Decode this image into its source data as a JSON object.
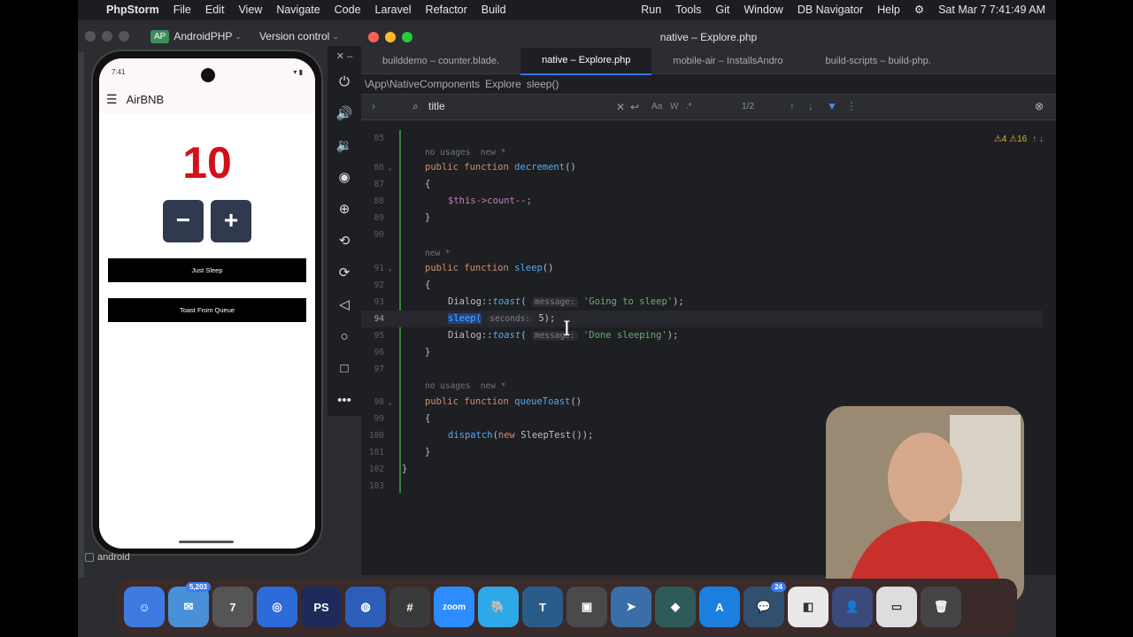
{
  "menubar": {
    "app": "PhpStorm",
    "items": [
      "File",
      "Edit",
      "View",
      "Navigate",
      "Code",
      "Laravel",
      "Refactor",
      "Build"
    ],
    "right_items": [
      "Run",
      "Tools",
      "Git",
      "Window",
      "DB Navigator",
      "Help"
    ],
    "clock": "Sat Mar 7  7:41:49 AM"
  },
  "toolbar": {
    "project_badge": "AP",
    "project": "AndroidPHP",
    "vcs": "Version control"
  },
  "phone": {
    "status_time": "7:41",
    "app_title": "AirBNB",
    "counter": "10",
    "minus": "−",
    "plus": "+",
    "button1": "Just Sleep",
    "button2": "Toast From Queue"
  },
  "emulator_label": "android",
  "editor": {
    "window_title": "native – Explore.php",
    "tabs": [
      "builddemo – counter.blade.",
      "native – Explore.php",
      "mobile-air – InstallsAndro",
      "build-scripts – build-php."
    ],
    "crumbs": [
      "\\App\\NativeComponents",
      "Explore",
      "sleep()"
    ],
    "find_value": "title",
    "find_count": "1/2",
    "warnings": "⚠4  ⚠16",
    "usages_none": "no usages  new *",
    "new_marker": "new *",
    "line_numbers": [
      "85",
      "86",
      "87",
      "88",
      "89",
      "90",
      "91",
      "92",
      "93",
      "94",
      "95",
      "96",
      "97",
      "98",
      "99",
      "100",
      "101",
      "102",
      "103"
    ],
    "code": {
      "l86_kw": "public function ",
      "l86_fn": "decrement",
      "l86_rest": "()",
      "brace_open": "{",
      "brace_close": "}",
      "l88": "$this->count--;",
      "l91_kw": "public function ",
      "l91_fn": "sleep",
      "l91_rest": "()",
      "l93_cls": "Dialog::",
      "l93_fn": "toast",
      "l93_hint": "message:",
      "l93_str": "'Going to sleep'",
      "l94_fn": "sleep(",
      "l94_hint": "seconds:",
      "l94_rest": "5);",
      "l95_cls": "Dialog::",
      "l95_fn": "toast",
      "l95_hint": "message:",
      "l95_str": "'Done sleeping'",
      "l98_kw": "public function ",
      "l98_fn": "queueToast",
      "l98_rest": "()",
      "l100_fn": "dispatch",
      "l100_kw": "new ",
      "l100_rest": "SleepTest());",
      "close_paren": "(",
      "end_stmt": ");"
    }
  },
  "dock": {
    "mail_badge": "5,203",
    "cal_day": "7",
    "msg_badge": "24",
    "ps_label": "PS",
    "zoom_label": "zoom"
  },
  "colors": {
    "accent": "#3574f0",
    "counter": "#d3101a",
    "button_dark": "#2f3a4f"
  }
}
